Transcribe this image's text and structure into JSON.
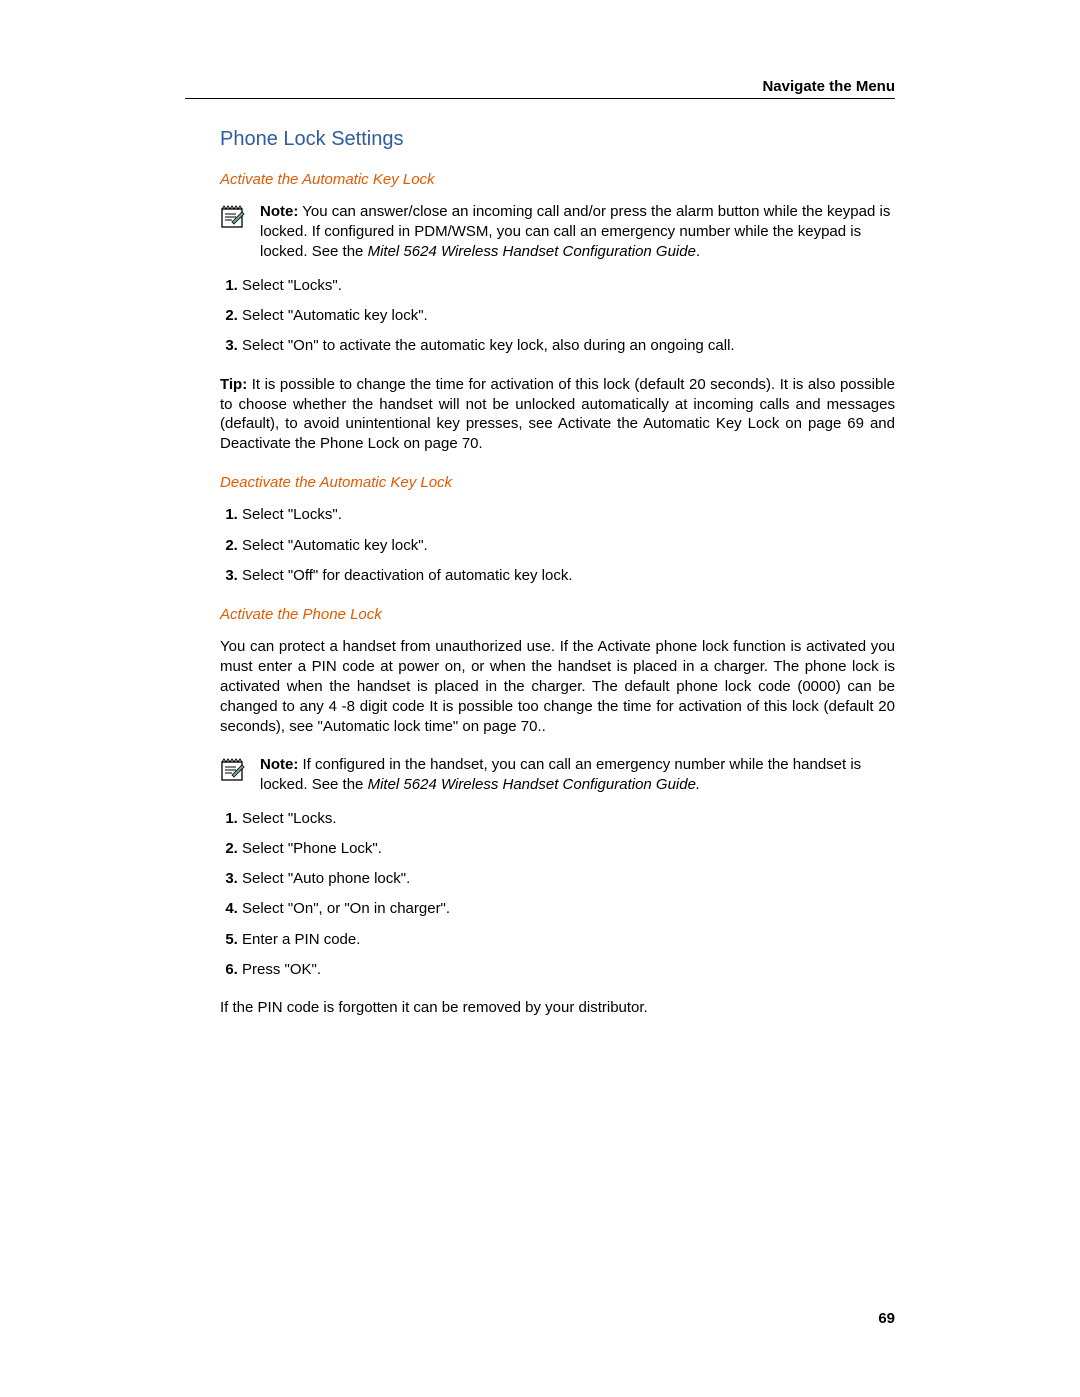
{
  "header": {
    "right": "Navigate the Menu"
  },
  "page_number": "69",
  "section": {
    "title": "Phone Lock Settings",
    "sub1": {
      "heading": "Activate the Automatic Key Lock",
      "note_label": "Note:",
      "note_body": " You can answer/close an incoming call and/or press the alarm button while the keypad is locked. If configured in PDM/WSM, you can call an emergency number while the keypad is locked. See the ",
      "note_italic": "Mitel 5624 Wireless Handset Configuration Guide",
      "note_end": ".",
      "steps": [
        "Select \"Locks\".",
        "Select \"Automatic key lock\".",
        "Select \"On\" to activate the automatic key lock, also during an ongoing call."
      ],
      "tip_label": "Tip:",
      "tip_body": " It is possible to change the time for activation of this lock (default 20 seconds). It is also possible to choose whether the handset will not be unlocked automatically at incoming calls and messages (default), to avoid unintentional key presses, see Activate the Automatic Key Lock on page 69 and Deactivate the Phone Lock on page 70."
    },
    "sub2": {
      "heading": "Deactivate the Automatic Key Lock",
      "steps": [
        "Select \"Locks\".",
        "Select \"Automatic key lock\".",
        "Select \"Off\" for deactivation of automatic key lock."
      ]
    },
    "sub3": {
      "heading": "Activate the Phone Lock",
      "intro": "You can protect a handset from unauthorized use. If the Activate phone lock function is activated you must enter a PIN code at power on, or when the handset is placed in a charger. The phone lock is activated when the handset is placed in the charger. The default phone lock code (0000) can be changed to any 4 -8 digit code It is possible too change the time for activation of this lock (default 20 seconds), see \"Automatic lock time\" on page 70..",
      "note_label": "Note:",
      "note_body": " If configured in the handset, you can call an emergency number while the handset is locked. See the ",
      "note_italic": "Mitel 5624 Wireless Handset Configuration Guide.",
      "steps": [
        "Select \"Locks.",
        "Select \"Phone Lock\".",
        "Select \"Auto phone lock\".",
        "Select \"On\", or \"On in charger\".",
        "Enter a PIN code.",
        "Press \"OK\"."
      ],
      "closing": "If the PIN code is forgotten it can be removed by your distributor."
    }
  }
}
